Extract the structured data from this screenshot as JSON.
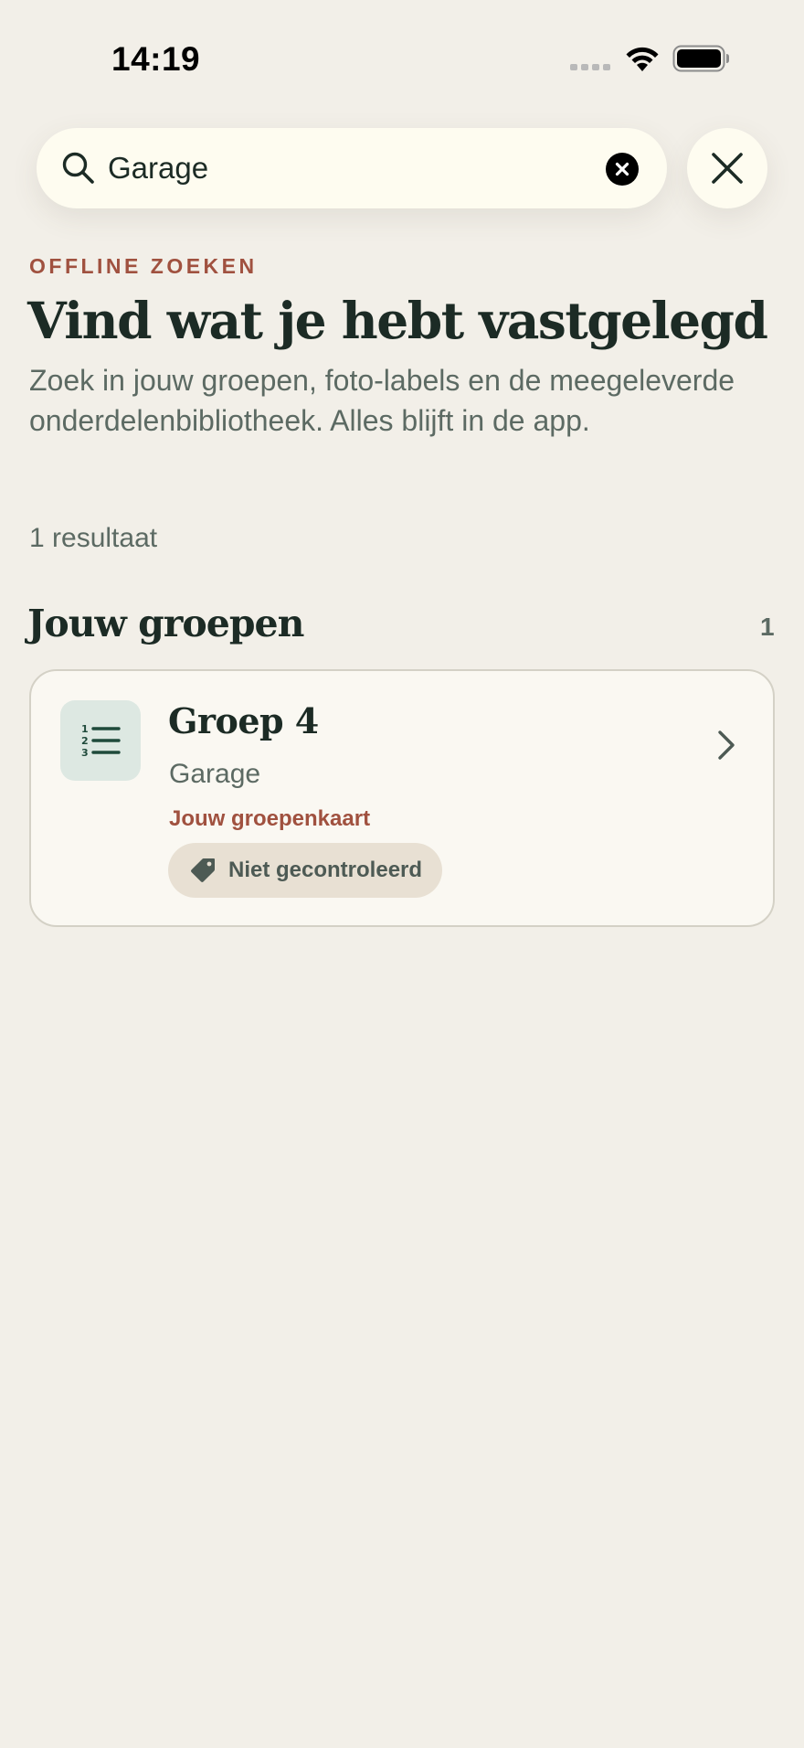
{
  "status_bar": {
    "time": "14:19"
  },
  "search": {
    "value": "Garage",
    "placeholder": "",
    "icons": {
      "search": "search-icon",
      "clear": "clear-circle-icon",
      "close": "close-icon"
    }
  },
  "header": {
    "eyebrow": "OFFLINE ZOEKEN",
    "title": "Vind wat je hebt vastgelegd",
    "subtitle": "Zoek in jouw groepen, foto-labels en de meegeleverde onderdelenbibliotheek. Alles blijft in de app."
  },
  "results": {
    "count_label": "1 resultaat"
  },
  "sections": [
    {
      "title": "Jouw groepen",
      "count": "1",
      "items": [
        {
          "title": "Groep 4",
          "subtitle": "Garage",
          "source": "Jouw groepenkaart",
          "status": "Niet gecontroleerd",
          "icon": "numbered-list-icon"
        }
      ]
    }
  ],
  "colors": {
    "background": "#f2efe8",
    "accent": "#a0513f",
    "text_primary": "#1c2b25",
    "text_secondary": "#5c6a63",
    "search_fill": "#fefcf0",
    "card_fill": "#faf8f2",
    "icon_tile": "#dde8e2",
    "chip_fill": "#e8e0d3"
  }
}
